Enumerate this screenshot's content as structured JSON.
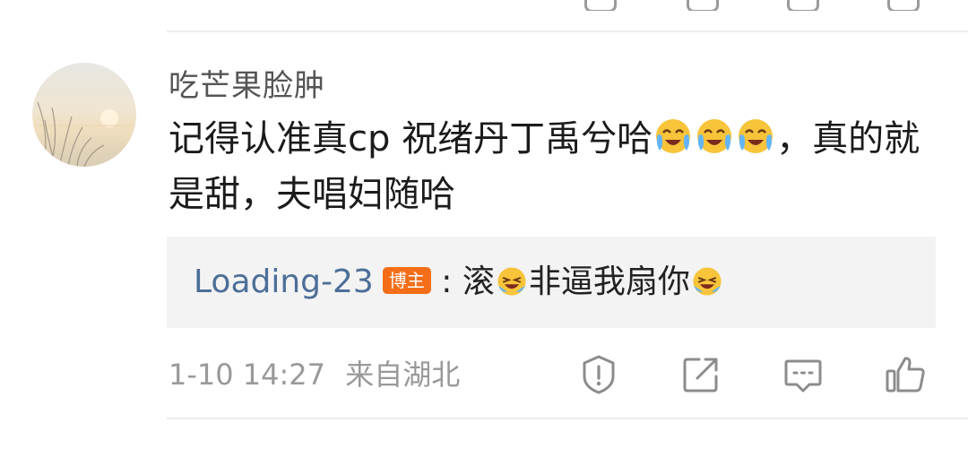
{
  "comment": {
    "username": "吃芒果脸肿",
    "text_part1": "记得认准真cp 祝绪丹丁禹兮哈",
    "text_part2": "，真的就是甜，夫唱妇随哈",
    "emojis": [
      "crying-laugh-emoji",
      "crying-laugh-emoji",
      "crying-laugh-emoji"
    ]
  },
  "reply": {
    "username": "Loading-23",
    "badge": "博主",
    "separator": ":",
    "text_part1": "滚",
    "text_part2": "非逼我扇你"
  },
  "meta": {
    "time": "1-10 14:27",
    "location": "来自湖北"
  },
  "actions": [
    "report-icon",
    "repost-icon",
    "comment-icon",
    "like-icon"
  ]
}
